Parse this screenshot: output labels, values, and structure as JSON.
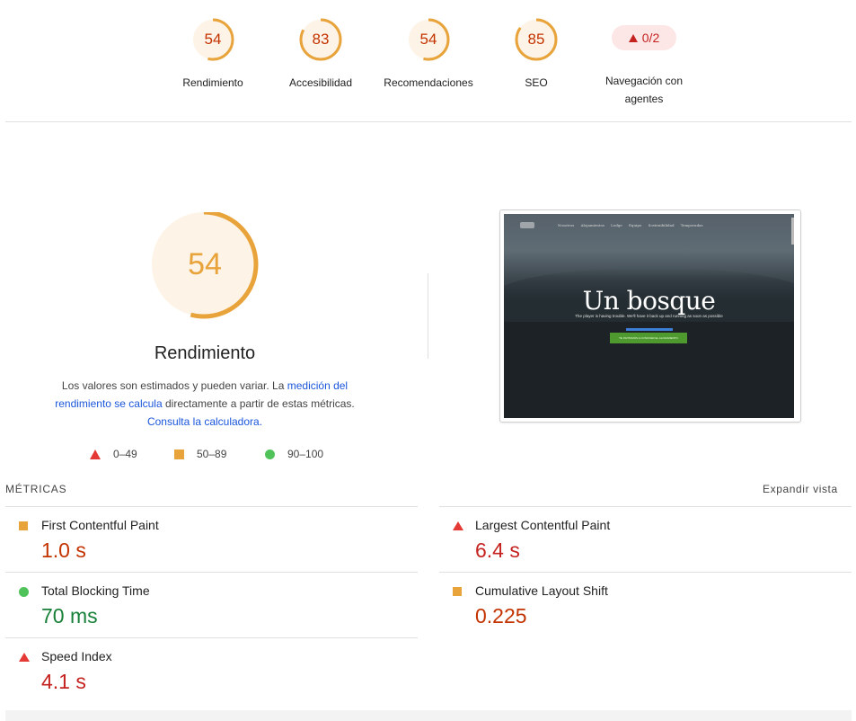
{
  "categories": [
    {
      "label": "Rendimiento",
      "score": "54",
      "fraction": 0.54
    },
    {
      "label": "Accesibilidad",
      "score": "83",
      "fraction": 0.83
    },
    {
      "label": "Recomendaciones",
      "score": "54",
      "fraction": 0.54
    },
    {
      "label": "SEO",
      "score": "85",
      "fraction": 0.85
    },
    {
      "label_line1": "Navegación con",
      "label_line2": "agentes",
      "badge": "0/2"
    }
  ],
  "performance": {
    "score": "54",
    "fraction": 0.54,
    "title": "Rendimiento",
    "desc_part1": "Los valores son estimados y pueden variar. La ",
    "desc_link1": "medición del rendimiento se calcula",
    "desc_part2": " directamente a partir de estas métricas. ",
    "desc_link2": "Consulta la calculadora."
  },
  "legend": [
    {
      "shape": "triangle",
      "range": "0–49",
      "color": "#e53935"
    },
    {
      "shape": "square",
      "range": "50–89",
      "color": "#e8a33a"
    },
    {
      "shape": "circle",
      "range": "90–100",
      "color": "#4fc35a"
    }
  ],
  "screenshot": {
    "nav": "Nosotros  Alojamientos  Lodge  Equipo  Sostenibilidad  Temporadas",
    "hero_title": "Un bosque",
    "hero_sub": "The player is having trouble. We'll have it back up and running as soon as possible",
    "hero_button": "TE INVITAMOS A CONOCER EL ALOJAMIENTO"
  },
  "metrics_section": {
    "header": "MÉTRICAS",
    "expand": "Expandir vista"
  },
  "metrics": [
    {
      "name": "First Contentful Paint",
      "value": "1.0 s",
      "status": "average"
    },
    {
      "name": "Largest Contentful Paint",
      "value": "6.4 s",
      "status": "fail"
    },
    {
      "name": "Total Blocking Time",
      "value": "70 ms",
      "status": "pass"
    },
    {
      "name": "Cumulative Layout Shift",
      "value": "0.225",
      "status": "average"
    },
    {
      "name": "Speed Index",
      "value": "4.1 s",
      "status": "fail"
    }
  ],
  "colors": {
    "average": "#e8a33a",
    "fail": "#e53935",
    "pass": "#4fc35a",
    "gauge_bg": "#fdf3e6"
  }
}
